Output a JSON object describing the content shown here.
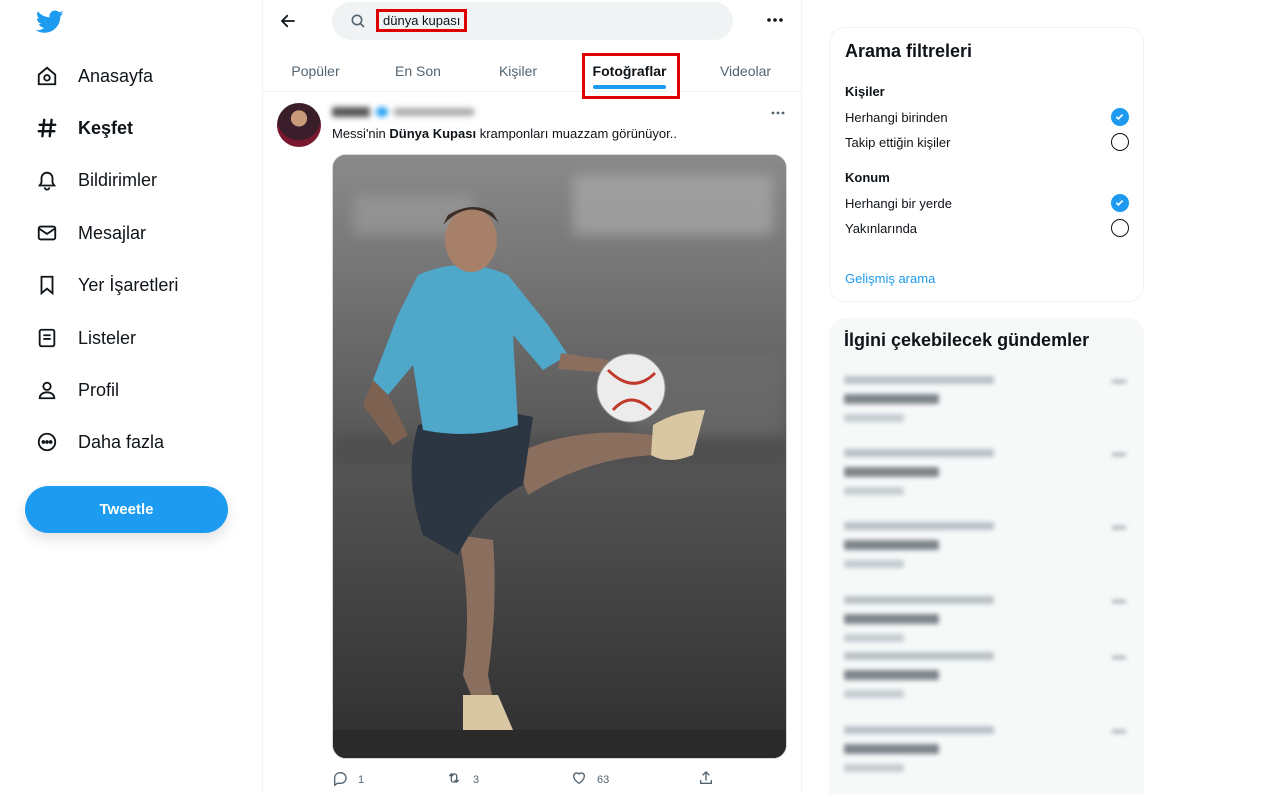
{
  "sidebar": {
    "logo": "twitter-bird-icon",
    "items": [
      {
        "label": "Anasayfa",
        "icon": "home-icon",
        "active": false
      },
      {
        "label": "Keşfet",
        "icon": "hashtag-icon",
        "active": true
      },
      {
        "label": "Bildirimler",
        "icon": "bell-icon",
        "active": false
      },
      {
        "label": "Mesajlar",
        "icon": "envelope-icon",
        "active": false
      },
      {
        "label": "Yer İşaretleri",
        "icon": "bookmark-icon",
        "active": false
      },
      {
        "label": "Listeler",
        "icon": "list-icon",
        "active": false
      },
      {
        "label": "Profil",
        "icon": "person-icon",
        "active": false
      },
      {
        "label": "Daha fazla",
        "icon": "more-circle-icon",
        "active": false
      }
    ],
    "tweet_button": "Tweetle"
  },
  "search": {
    "query": "dünya kupası"
  },
  "tabs": [
    {
      "label": "Popüler",
      "selected": false
    },
    {
      "label": "En Son",
      "selected": false
    },
    {
      "label": "Kişiler",
      "selected": false
    },
    {
      "label": "Fotoğraflar",
      "selected": true
    },
    {
      "label": "Videolar",
      "selected": false
    }
  ],
  "tweet": {
    "text_before": "Messi'nin ",
    "text_bold": "Dünya Kupası",
    "text_after": " kramponları muazzam görünüyor..",
    "replies": "1",
    "retweets": "3",
    "likes": "63"
  },
  "filters": {
    "title": "Arama filtreleri",
    "people_heading": "Kişiler",
    "people_options": [
      {
        "label": "Herhangi birinden",
        "checked": true
      },
      {
        "label": "Takip ettiğin kişiler",
        "checked": false
      }
    ],
    "location_heading": "Konum",
    "location_options": [
      {
        "label": "Herhangi bir yerde",
        "checked": true
      },
      {
        "label": "Yakınlarında",
        "checked": false
      }
    ],
    "advanced_link": "Gelişmiş arama"
  },
  "trends": {
    "title": "İlgini çekebilecek gündemler"
  },
  "colors": {
    "accent": "#1d9bf0",
    "highlight": "#e00000"
  }
}
